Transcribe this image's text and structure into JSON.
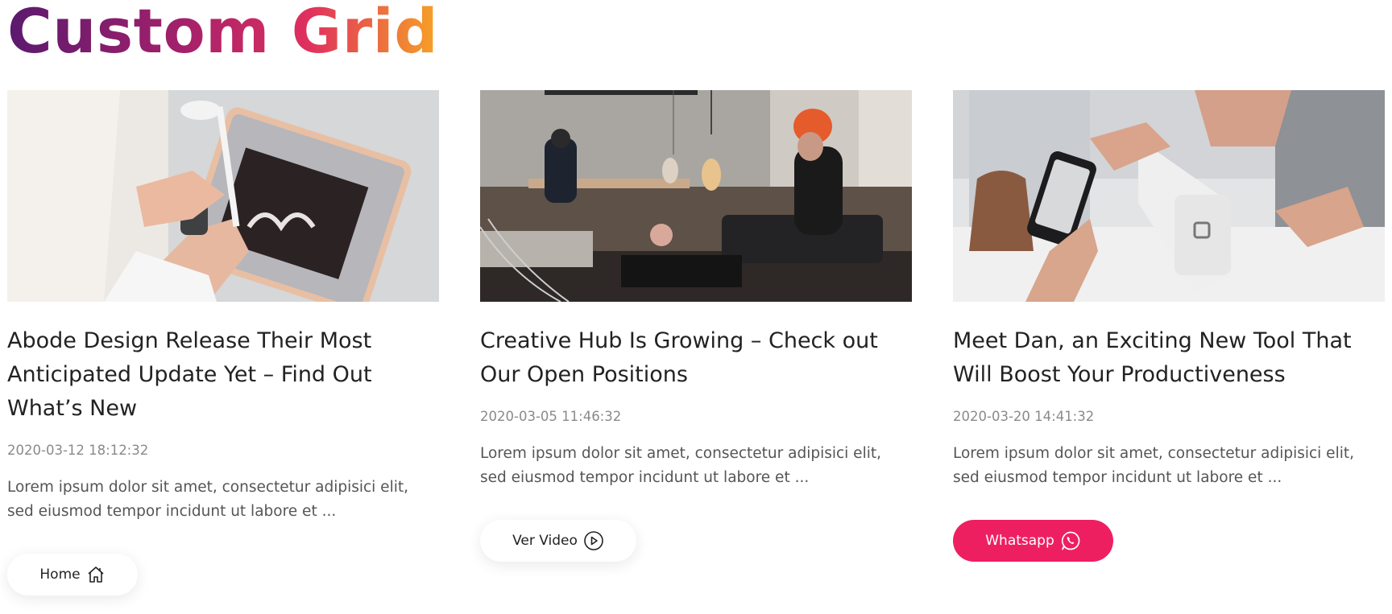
{
  "page": {
    "title": "Custom Grid"
  },
  "cards": [
    {
      "title": "Abode Design Release Their Most Anticipated Update Yet – Find Out What’s New",
      "date": "2020-03-12 18:12:32",
      "excerpt": "Lorem ipsum dolor sit amet, consectetur adipisici elit, sed eiusmod tempor incidunt ut labore et ...",
      "button": {
        "label": "Home",
        "icon": "home-icon",
        "style": "light"
      }
    },
    {
      "title": "Creative Hub Is Growing – Check out Our Open Positions",
      "date": "2020-03-05 11:46:32",
      "excerpt": "Lorem ipsum dolor sit amet, consectetur adipisici elit, sed eiusmod tempor incidunt ut labore et ...",
      "button": {
        "label": "Ver Video",
        "icon": "play-circle-icon",
        "style": "light"
      }
    },
    {
      "title": "Meet Dan, an Exciting New Tool That Will Boost Your Productiveness",
      "date": "2020-03-20 14:41:32",
      "excerpt": "Lorem ipsum dolor sit amet, consectetur adipisici elit, sed eiusmod tempor incidunt ut labore et ...",
      "button": {
        "label": "Whatsapp",
        "icon": "whatsapp-icon",
        "style": "accent"
      }
    }
  ],
  "colors": {
    "title_gradient": [
      "#5a1a6e",
      "#a3206b",
      "#e0305e",
      "#f6a226"
    ],
    "accent": "#ee1f61",
    "text": "#222222",
    "muted": "#8a8a8a"
  }
}
